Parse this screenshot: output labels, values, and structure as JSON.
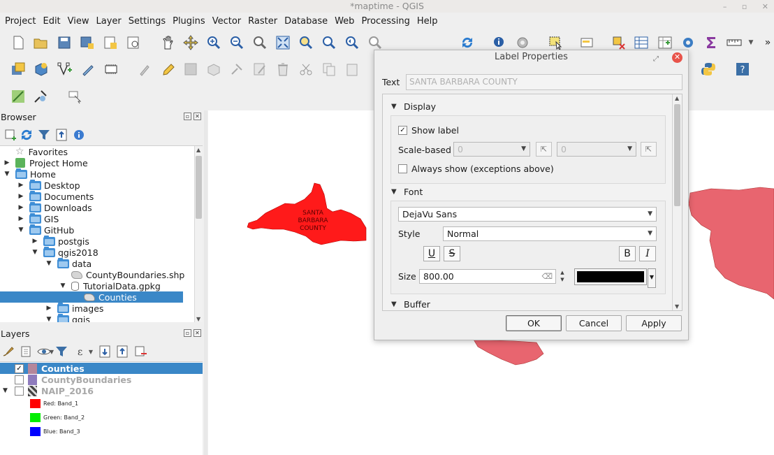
{
  "window": {
    "title": "*maptime - QGIS",
    "controls": [
      "–",
      "▫",
      "✕"
    ]
  },
  "menubar": {
    "items": [
      "Project",
      "Edit",
      "View",
      "Layer",
      "Settings",
      "Plugins",
      "Vector",
      "Raster",
      "Database",
      "Web",
      "Processing",
      "Help"
    ]
  },
  "toolbar": {
    "overflow_label": "»"
  },
  "browser": {
    "title": "Browser",
    "tree": [
      {
        "label": "Favorites",
        "level": 0,
        "icon": "star-icon"
      },
      {
        "label": "Project Home",
        "level": 0,
        "icon": "project-home-icon"
      },
      {
        "label": "Home",
        "level": 0,
        "icon": "folder-icon"
      },
      {
        "label": "Desktop",
        "level": 1,
        "icon": "folder-icon"
      },
      {
        "label": "Documents",
        "level": 1,
        "icon": "folder-icon"
      },
      {
        "label": "Downloads",
        "level": 1,
        "icon": "folder-icon"
      },
      {
        "label": "GIS",
        "level": 1,
        "icon": "folder-icon"
      },
      {
        "label": "GitHub",
        "level": 1,
        "icon": "folder-icon"
      },
      {
        "label": "postgis",
        "level": 2,
        "icon": "folder-icon"
      },
      {
        "label": "qgis2018",
        "level": 2,
        "icon": "folder-icon"
      },
      {
        "label": "data",
        "level": 3,
        "icon": "folder-icon"
      },
      {
        "label": "CountyBoundaries.shp",
        "level": 4,
        "icon": "shapefile-icon"
      },
      {
        "label": "TutorialData.gpkg",
        "level": 4,
        "icon": "geopackage-icon"
      },
      {
        "label": "Counties",
        "level": 5,
        "icon": "polygon-layer-icon",
        "selected": true
      },
      {
        "label": "images",
        "level": 3,
        "icon": "folder-icon"
      },
      {
        "label": "qgis",
        "level": 3,
        "icon": "folder-icon"
      }
    ]
  },
  "layers": {
    "title": "Layers",
    "items": [
      {
        "name": "Counties",
        "checked": true,
        "selected": true,
        "color": "#b4869b"
      },
      {
        "name": "CountyBoundaries",
        "checked": false,
        "selected": false,
        "color": "#8e7bbd"
      },
      {
        "name": "NAIP_2016",
        "checked": false,
        "selected": false,
        "color": "raster"
      }
    ],
    "bands": [
      {
        "label": "Red:  Band_1",
        "color": "#ff0000"
      },
      {
        "label": "Green:  Band_2",
        "color": "#00ee00"
      },
      {
        "label": "Blue:  Band_3",
        "color": "#0000ff"
      }
    ]
  },
  "map": {
    "county_label": [
      "SANTA",
      "BARBARA",
      "COUNTY"
    ],
    "county_fill": "#ff1a1a",
    "neighbor_fill": "#e8656f"
  },
  "dialog": {
    "title": "Label Properties",
    "text_label": "Text",
    "text_value": "SANTA BARBARA COUNTY",
    "display": {
      "header": "Display",
      "show_label": "Show label",
      "show_label_checked": true,
      "scale_based": "Scale-based",
      "scale_min": "0",
      "scale_max": "0",
      "always_show": "Always show (exceptions above)",
      "always_show_checked": false
    },
    "font": {
      "header": "Font",
      "family": "DejaVu Sans",
      "style_label": "Style",
      "style": "Normal",
      "underline": "U",
      "strike": "S",
      "bold": "B",
      "italic": "I",
      "size_label": "Size",
      "size": "800.00",
      "color": "#000000"
    },
    "buffer": {
      "header": "Buffer"
    },
    "buttons": {
      "ok": "OK",
      "cancel": "Cancel",
      "apply": "Apply"
    }
  }
}
